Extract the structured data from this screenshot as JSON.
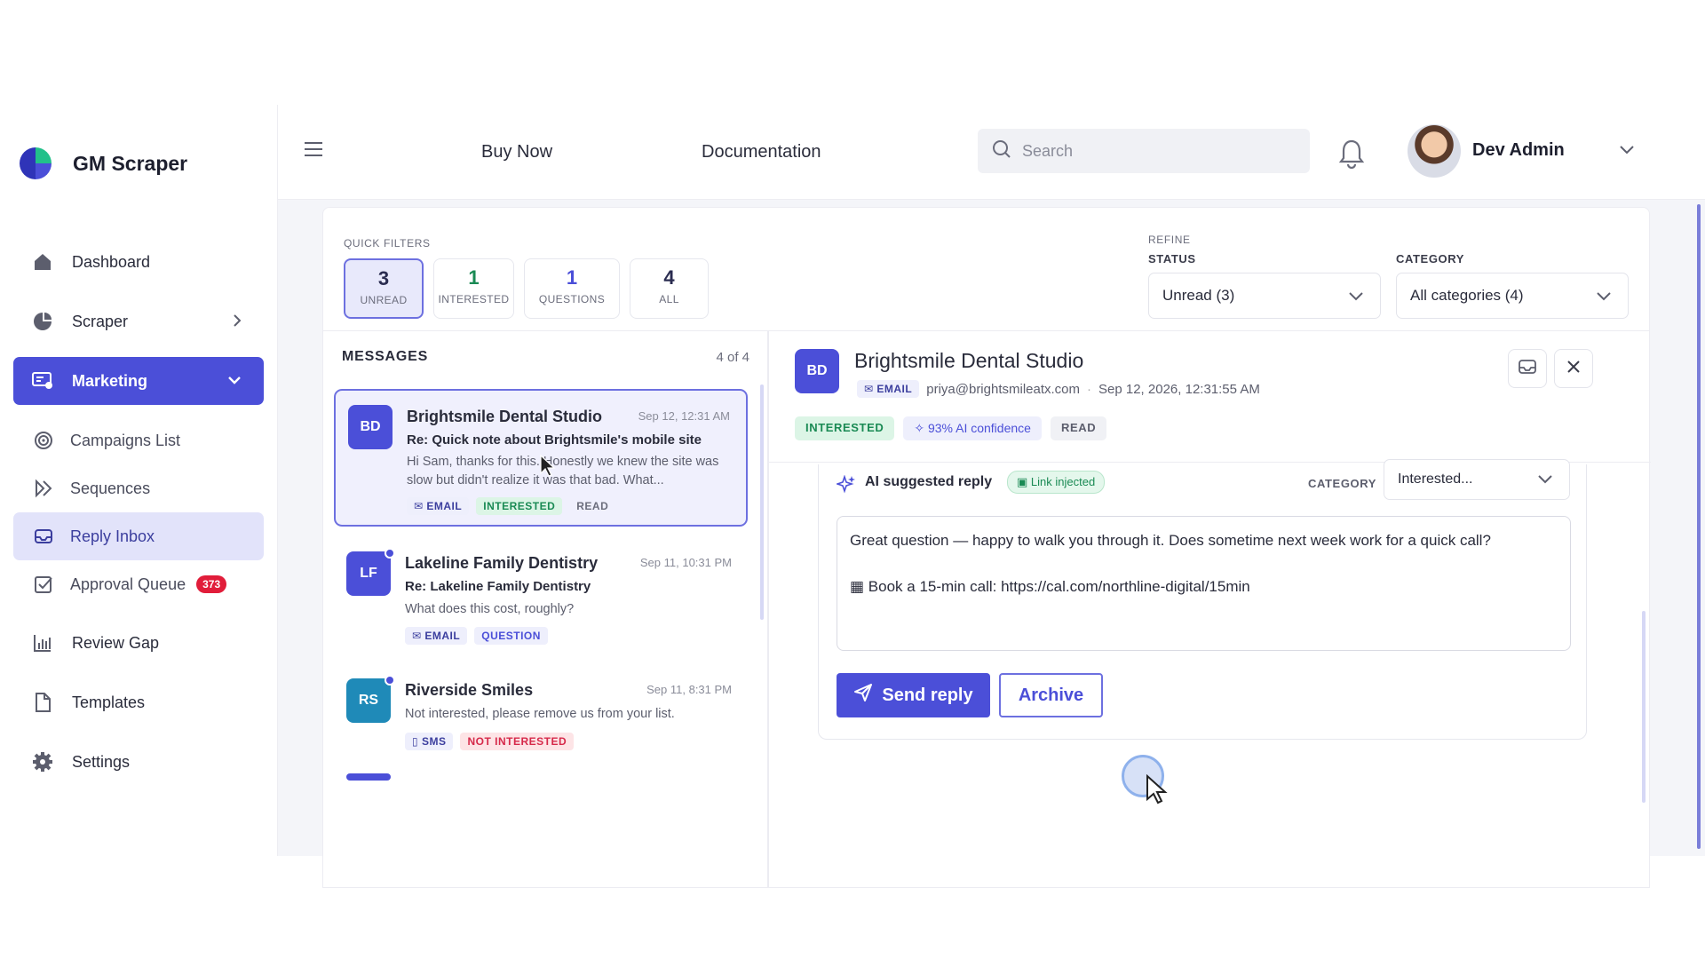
{
  "brand": {
    "name": "GM Scraper"
  },
  "sidebar": {
    "items": [
      {
        "label": "Dashboard",
        "icon": "home-icon"
      },
      {
        "label": "Scraper",
        "icon": "pie-icon"
      },
      {
        "label": "Marketing",
        "icon": "marketing-icon"
      }
    ],
    "sub_items": [
      {
        "label": "Campaigns List",
        "icon": "target-icon"
      },
      {
        "label": "Sequences",
        "icon": "sequence-icon"
      },
      {
        "label": "Reply Inbox",
        "icon": "inbox-icon"
      },
      {
        "label": "Approval Queue",
        "icon": "checkbox-icon",
        "badge": "373"
      }
    ],
    "bottom_items": [
      {
        "label": "Review Gap",
        "icon": "bar-chart-icon"
      },
      {
        "label": "Templates",
        "icon": "file-icon"
      },
      {
        "label": "Settings",
        "icon": "gear-icon"
      }
    ]
  },
  "topbar": {
    "links": [
      "Buy Now",
      "Documentation"
    ],
    "search_placeholder": "Search",
    "user_name": "Dev Admin"
  },
  "filters": {
    "quick_title": "QUICK FILTERS",
    "quick": [
      {
        "num": "3",
        "cap": "UNREAD"
      },
      {
        "num": "1",
        "cap": "INTERESTED"
      },
      {
        "num": "1",
        "cap": "QUESTIONS"
      },
      {
        "num": "4",
        "cap": "ALL"
      }
    ],
    "refine": "REFINE",
    "status_label": "STATUS",
    "status_value": "Unread (3)",
    "category_label": "CATEGORY",
    "category_value": "All categories (4)"
  },
  "messages": {
    "title": "MESSAGES",
    "count": "4 of 4",
    "items": [
      {
        "initials": "BD",
        "name": "Brightsmile Dental Studio",
        "time": "Sep 12, 12:31 AM",
        "subject": "Re: Quick note about Brightsmile's mobile site",
        "preview": "Hi Sam, thanks for this. Honestly we knew the site was slow but didn't realize it was that bad. What...",
        "tags": [
          "EMAIL",
          "INTERESTED",
          "READ"
        ]
      },
      {
        "initials": "LF",
        "name": "Lakeline Family Dentistry",
        "time": "Sep 11, 10:31 PM",
        "subject": "Re: Lakeline Family Dentistry",
        "preview": "What does this cost, roughly?",
        "tags": [
          "EMAIL",
          "QUESTION"
        ]
      },
      {
        "initials": "RS",
        "name": "Riverside Smiles",
        "time": "Sep 11, 8:31 PM",
        "preview": "Not interested, please remove us from your list.",
        "tags": [
          "SMS",
          "NOT INTERESTED"
        ]
      }
    ]
  },
  "detail": {
    "initials": "BD",
    "name": "Brightsmile Dental Studio",
    "channel": "EMAIL",
    "email": "priya@brightsmileatx.com",
    "sep": "·",
    "timestamp": "Sep 12, 2026, 12:31:55 AM",
    "tags": {
      "status": "INTERESTED",
      "confidence": "93% AI confidence",
      "read": "READ"
    },
    "ai_label": "AI suggested reply",
    "link_injected": "Link injected",
    "category_label": "CATEGORY",
    "category_value": "Interested...",
    "reply_line1": "Great question — happy to walk you through it. Does sometime next week work for a quick call?",
    "reply_line2": "Book a 15-min call: https://cal.com/northline-digital/15min",
    "send_label": "Send reply",
    "archive_label": "Archive"
  },
  "colors": {
    "accent": "#4b4fd8",
    "green": "#1a8a54",
    "red": "#e11d3a"
  }
}
